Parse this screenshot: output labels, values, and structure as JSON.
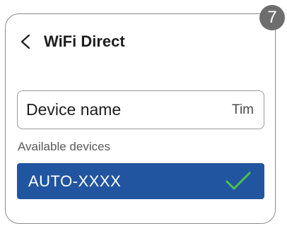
{
  "step_badge": "7",
  "header": {
    "back_icon": "chevron-left-icon",
    "title": "WiFi Direct"
  },
  "device_name_field": {
    "label": "Device name",
    "value": "Tim"
  },
  "available_devices": {
    "label": "Available devices",
    "items": [
      {
        "name": "AUTO-XXXX",
        "selected": true,
        "status_icon": "checkmark-icon"
      }
    ]
  },
  "colors": {
    "selected_row": "#2255a0",
    "check": "#4cc24c",
    "badge": "#6e6e6e",
    "border": "#8a8a8a"
  }
}
